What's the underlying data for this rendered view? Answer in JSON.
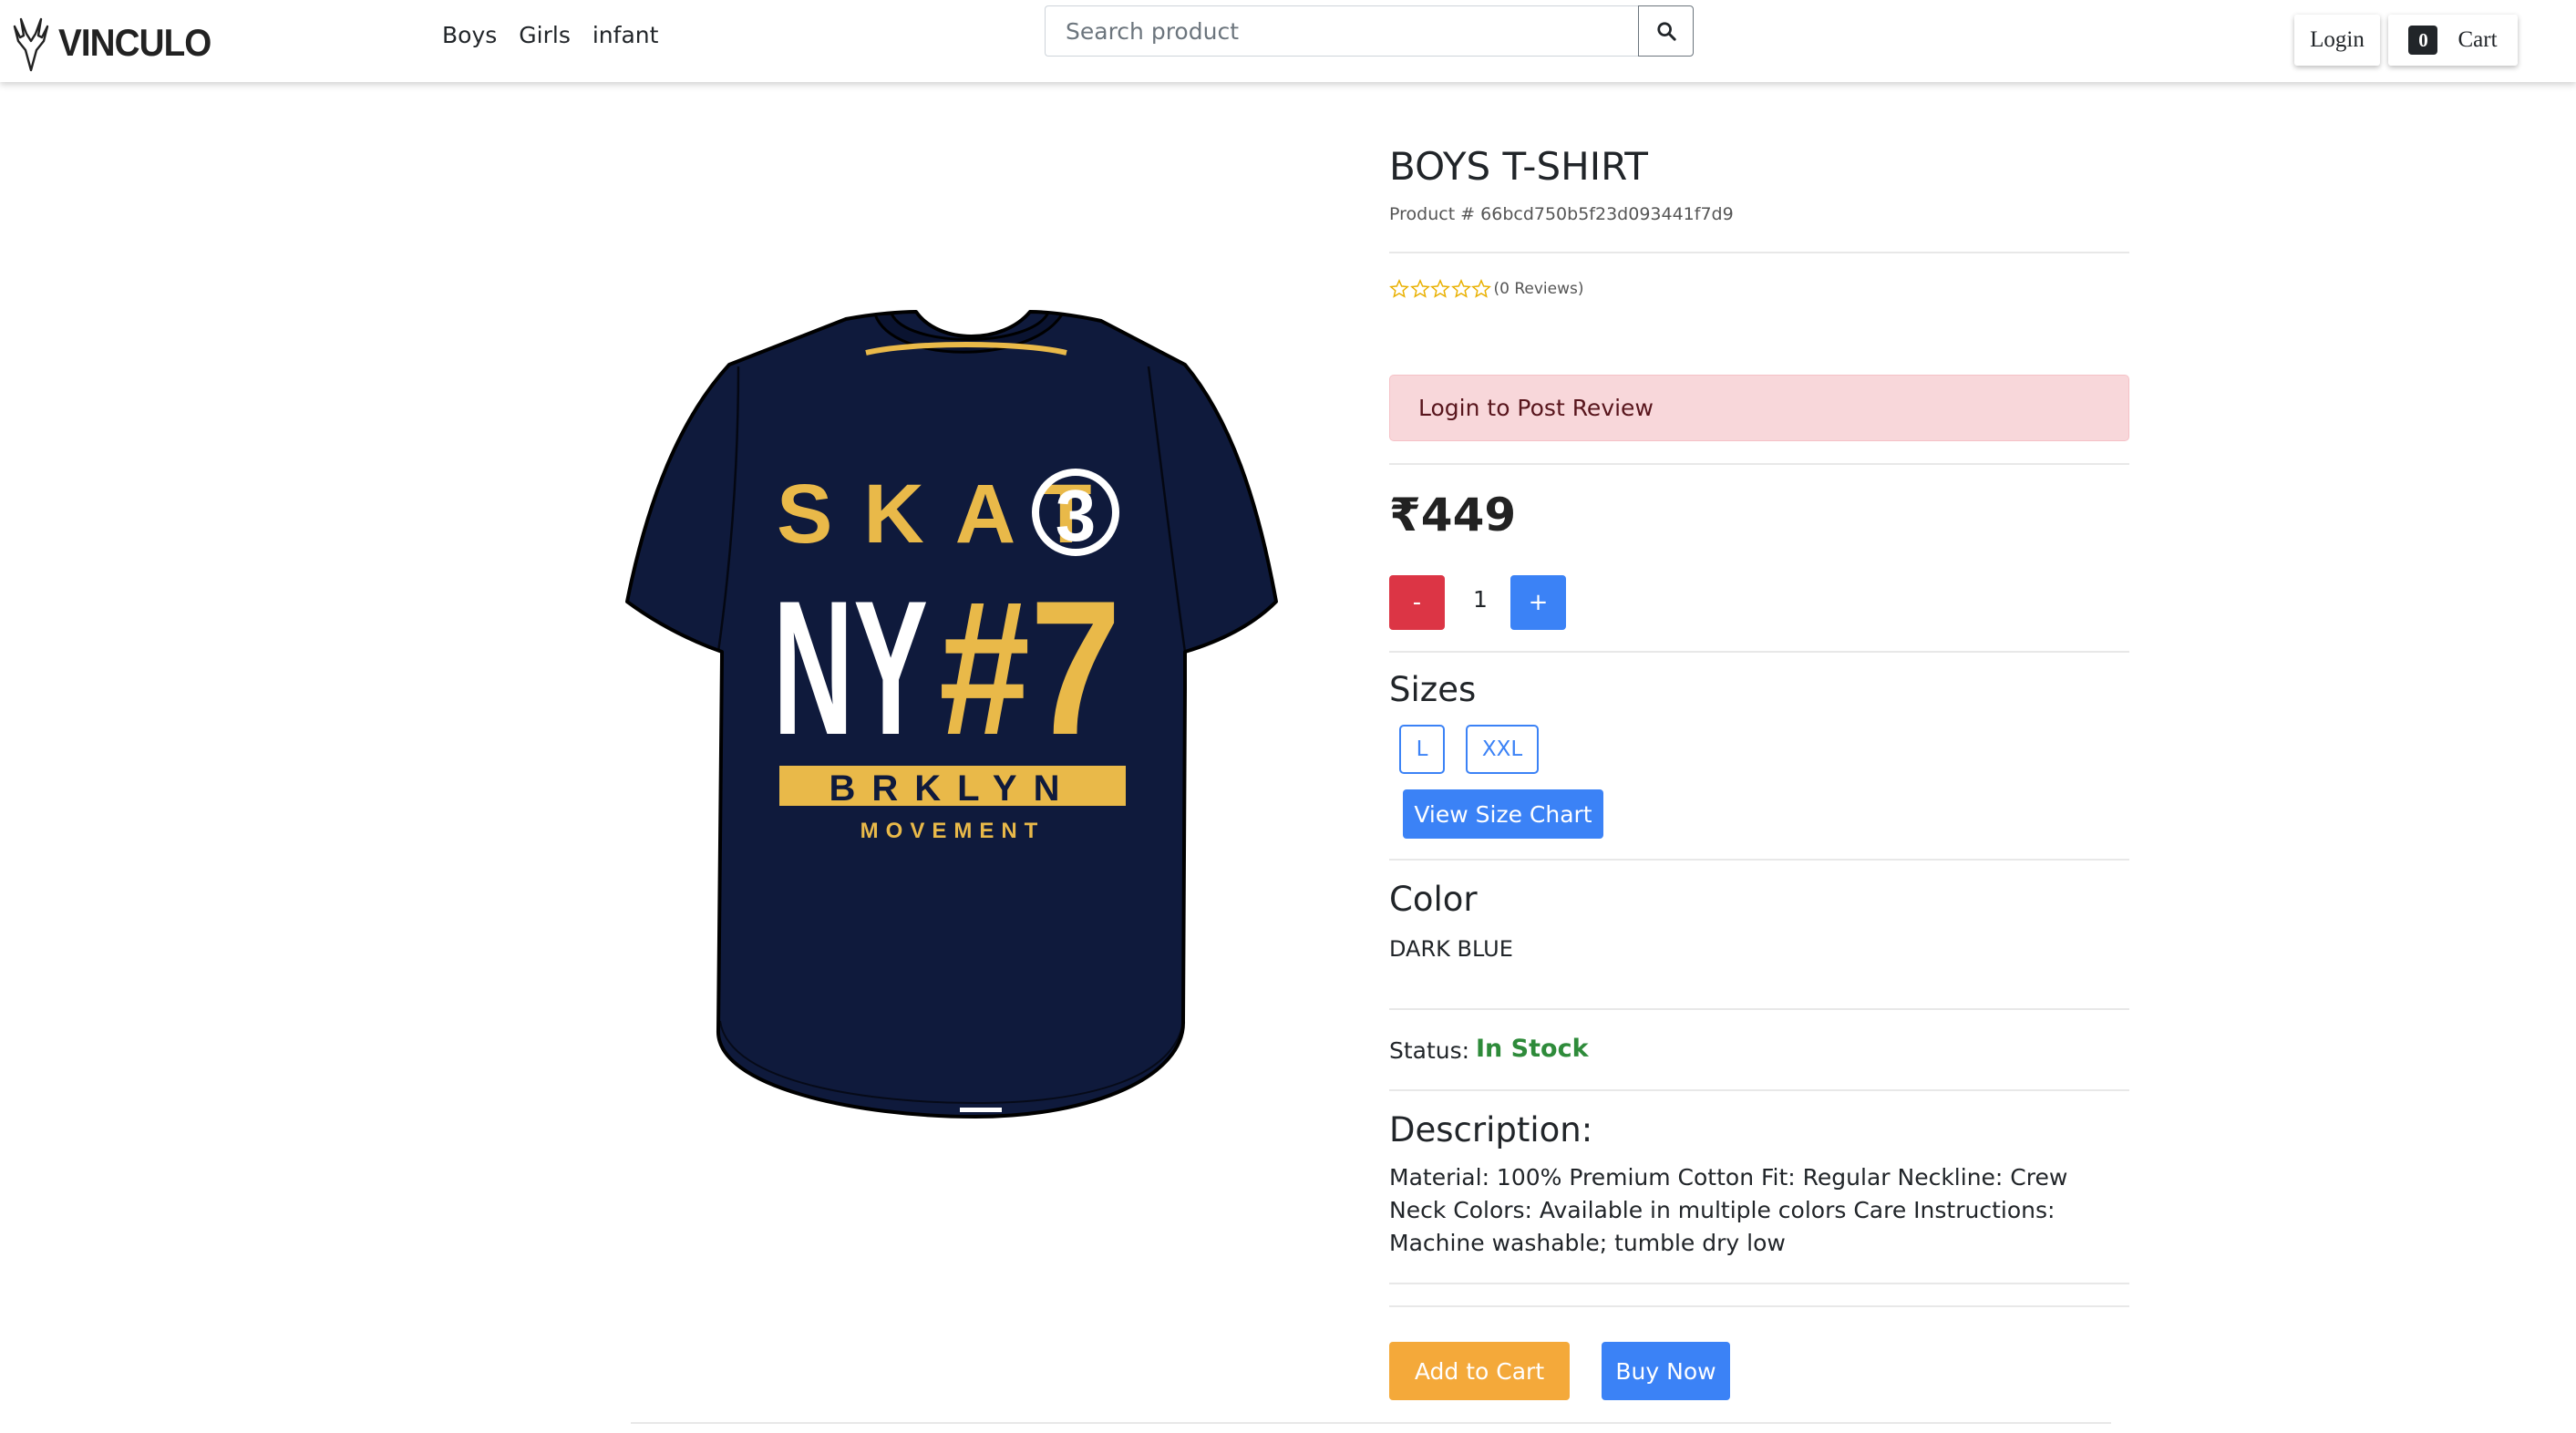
{
  "navbar": {
    "brand": "VINCULO",
    "links": [
      "Boys",
      "Girls",
      "infant"
    ],
    "search_placeholder": "Search product",
    "login_label": "Login",
    "cart_count": "0",
    "cart_label": "Cart"
  },
  "product": {
    "title": "BOYS T-SHIRT",
    "product_id": "Product # 66bcd750b5f23d093441f7d9",
    "rating": 0,
    "reviews_label": "(0 Reviews)",
    "review_alert": "Login to Post Review",
    "price": "₹449",
    "quantity": "1",
    "qty_minus": "-",
    "qty_plus": "+",
    "sizes_heading": "Sizes",
    "sizes": [
      "L",
      "XXL"
    ],
    "size_chart_label": "View Size Chart",
    "color_heading": "Color",
    "color_value": "DARK BLUE",
    "status_label": "Status:",
    "status_value": "In Stock",
    "description_heading": "Description:",
    "description": "Material: 100% Premium Cotton Fit: Regular Neckline: Crew Neck Colors: Available in multiple colors Care Instructions: Machine washable; tumble dry low",
    "add_to_cart_label": "Add to Cart",
    "buy_now_label": "Buy Now",
    "shirt_print": {
      "line1": "SKAT",
      "badge": "3",
      "line2a": "NY",
      "line2b": "#7",
      "line3": "BRKLYN",
      "line4": "MOVEMENT"
    }
  },
  "colors": {
    "danger": "#dc3545",
    "primary": "#3b82f6",
    "warning": "#f4a93a",
    "success": "#2e8b3a",
    "shirt_navy": "#0f1a3c",
    "shirt_gold": "#e9b949",
    "star": "#e9b000"
  },
  "icons": {
    "brand_logo": "antler-logo-icon",
    "search": "search-icon",
    "rating": "star-outline-icon"
  }
}
